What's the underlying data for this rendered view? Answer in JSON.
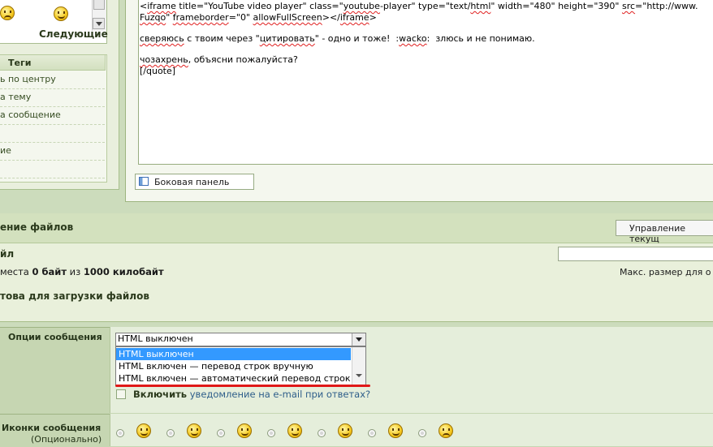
{
  "smilies": {
    "next_label": "Следующие",
    "icons": [
      "frown-smiley-icon",
      "grin-smiley-icon"
    ]
  },
  "tags": {
    "title": "Теги",
    "items": [
      "ь по центру",
      "а тему",
      "а сообщение",
      "",
      "ие",
      ""
    ]
  },
  "editor": {
    "lines": [
      "<iframe title=\"YouTube video player\" class=\"youtube-player\" type=\"text/html\" width=\"480\" height=\"390\" src=\"http://www.",
      "Fuzqo\" frameborder=\"0\" allowFullScreen></iframe>",
      "",
      "сверяюсь с твоим через \"цитировать\" - одно и тоже!  :wacko:  злюсь и не понимаю.",
      "",
      "чозахрень, объясни пожалуйста?",
      "[/quote]"
    ],
    "side_panel_label": "Боковая панель"
  },
  "attachments": {
    "title": "ение файлов",
    "manage_label": "Управление текущ",
    "file_label": "йл",
    "space_info": {
      "prefix": "места ",
      "used": "0 байт",
      "middle": " из ",
      "limit": "1000 килобайт"
    },
    "maxsize_label": "Макс. размер для о",
    "ready_title": "това для загрузки файлов"
  },
  "options": {
    "label": "Опции сообщения",
    "selected_value": "HTML выключен",
    "dropdown_options": [
      "HTML выключен",
      "HTML включен — перевод строк вручную",
      "HTML включен — автоматический перевод строк"
    ],
    "notify_strong": "Включить",
    "notify_rest": " уведомление на e-mail при ответах?"
  },
  "message_icons": {
    "label": "Иконки сообщения",
    "sublabel": "(Опционально)",
    "icons": [
      "smile-icon",
      "cool-icon",
      "cool-icon-2",
      "wink-icon",
      "shocked-icon",
      "biggrin-icon",
      "angry-icon"
    ]
  },
  "colors": {
    "selected_option": "#3399ff",
    "annotation_underline": "#e01818",
    "panel_green": "#e9efdd"
  }
}
